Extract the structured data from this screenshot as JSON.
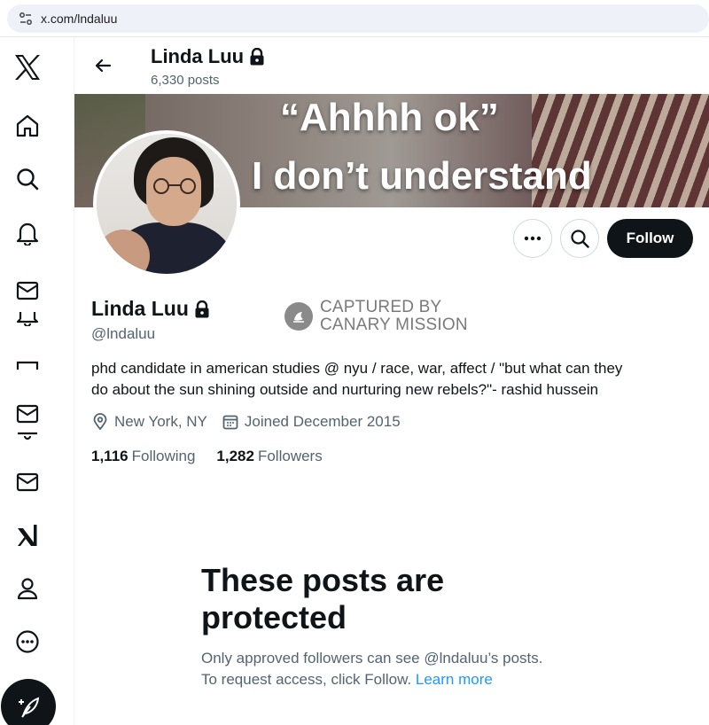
{
  "browser": {
    "url": "x.com/lndaluu"
  },
  "header": {
    "name": "Linda Luu",
    "posts_count": "6,330 posts"
  },
  "banner": {
    "line1": "“Ahhhh ok”",
    "line2": "I don’t understand"
  },
  "actions": {
    "follow_label": "Follow"
  },
  "profile": {
    "name": "Linda Luu",
    "handle": "@lndaluu",
    "bio_line1": "phd candidate in american studies @ nyu / race, war, affect / \"but what can they",
    "bio_line2": "do about the sun shining outside and nurturing new rebels?\"- rashid hussein",
    "location": "New York, NY",
    "joined": "Joined December 2015",
    "following_count": "1,116",
    "following_label": "Following",
    "followers_count": "1,282",
    "followers_label": "Followers"
  },
  "watermark": {
    "line1": "CAPTURED BY",
    "line2": "CANARY MISSION"
  },
  "protected": {
    "title_line1": "These posts are",
    "title_line2": "protected",
    "desc_line1": "Only approved followers can see @lndaluu’s posts.",
    "desc_line2": "To request access, click Follow.",
    "learn_more": "Learn more"
  },
  "sidebar": {
    "items": [
      "x-logo-icon",
      "home-icon",
      "search-icon",
      "notifications-icon",
      "messages-icon",
      "grok-icon",
      "messages-icon",
      "bookmarks-icon",
      "mail-icon",
      "grok-icon",
      "profile-icon",
      "more-icon",
      "compose-icon"
    ]
  }
}
